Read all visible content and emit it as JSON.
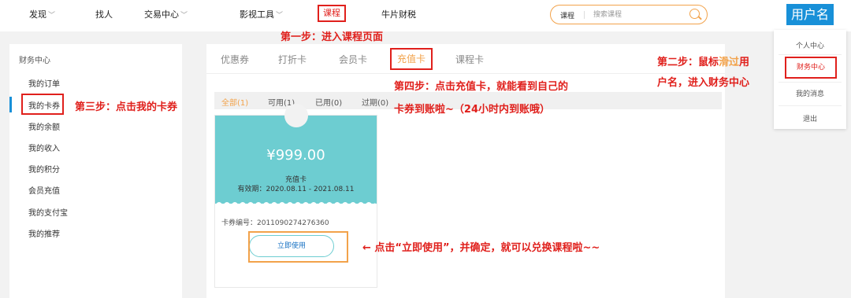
{
  "topnav": {
    "items": [
      {
        "label": "发现",
        "dropdown": true
      },
      {
        "label": "找人",
        "dropdown": false
      },
      {
        "label": "交易中心",
        "dropdown": true
      },
      {
        "label": "影视工具",
        "dropdown": true
      },
      {
        "label": "课程",
        "dropdown": false,
        "highlighted": true
      },
      {
        "label": "牛片财税",
        "dropdown": false
      }
    ],
    "search": {
      "kind": "课程",
      "placeholder": "搜索课程"
    },
    "user_button": "用户名"
  },
  "user_menu": {
    "items": [
      "个人中心",
      "财务中心",
      "我的消息",
      "退出"
    ],
    "highlighted": "财务中心"
  },
  "sidebar": {
    "title": "财务中心",
    "items": [
      "我的订单",
      "我的卡券",
      "我的余额",
      "我的收入",
      "我的积分",
      "会员充值",
      "我的支付宝",
      "我的推荐"
    ],
    "active_index": 1
  },
  "main": {
    "tabs": [
      "优惠券",
      "打折卡",
      "会员卡",
      "充值卡",
      "课程卡"
    ],
    "active_tab_index": 3,
    "filters": [
      "全部(1)",
      "可用(1)",
      "已用(0)",
      "过期(0)"
    ],
    "active_filter_index": 0
  },
  "card": {
    "amount": "¥999.00",
    "type": "充值卡",
    "validity": "有效期：2020.08.11 - 2021.08.11",
    "card_number": "卡券编号：2011090274276360",
    "use_button": "立即使用"
  },
  "annotations": {
    "step1": "第一步：进入课程页面",
    "step2_a": "第二步：鼠标",
    "step2_b": "滑过",
    "step2_c": "用",
    "step2_d": "户名，进入财务中心",
    "step3": "第三步：点击我的卡券",
    "step4_a": "第四步：点击充值卡，就能看到自己的",
    "step4_b": "卡券到账啦~（24小时内到账哦）",
    "step5": "← 点击“立即使用”，并确定，就可以兑换课程啦~~"
  },
  "colors": {
    "annotation_red": "#e0201c",
    "accent_orange": "#f2a24a",
    "brand_blue": "#1890d8",
    "card_teal": "#6dcdd1"
  }
}
